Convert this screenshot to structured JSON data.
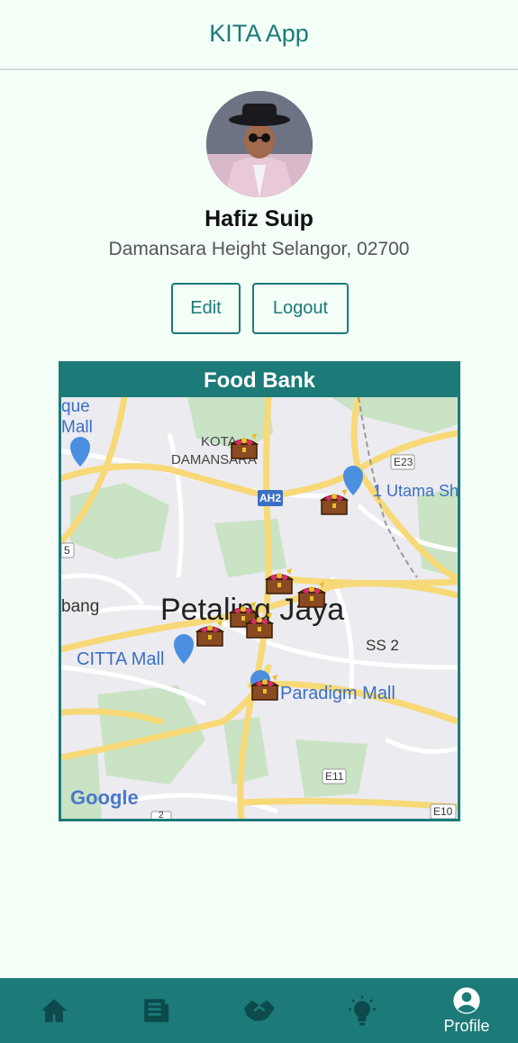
{
  "app": {
    "title": "KITA App"
  },
  "profile": {
    "name": "Hafiz Suip",
    "address": "Damansara Height Selangor, 02700",
    "edit_label": "Edit",
    "logout_label": "Logout"
  },
  "food_bank": {
    "title": "Food Bank",
    "map_labels": {
      "kota_1": "KOTA",
      "kota_2": "DAMANSARA",
      "petaling_jaya": "Petaling Jaya",
      "utama": "1 Utama Sh",
      "citta": "CITTA Mall",
      "paradigm": "Paradigm Mall",
      "ss2": "SS 2",
      "ah2": "AH2",
      "e23": "E23",
      "e11": "E11",
      "e10": "E10",
      "route_5": "5",
      "route_2": "2",
      "edge_que": "que",
      "edge_mall": "Mall",
      "edge_bang": "bang",
      "google": "Google"
    },
    "marker_count": 8
  },
  "nav": {
    "items": [
      {
        "icon": "home-icon",
        "label": ""
      },
      {
        "icon": "news-icon",
        "label": ""
      },
      {
        "icon": "handshake-icon",
        "label": ""
      },
      {
        "icon": "lightbulb-icon",
        "label": ""
      },
      {
        "icon": "account-circle-icon",
        "label": "Profile"
      }
    ],
    "active_color": "#ffffff",
    "bar_color": "#1c7a78"
  },
  "colors": {
    "accent": "#1c7a78",
    "background": "#f4fff8"
  }
}
